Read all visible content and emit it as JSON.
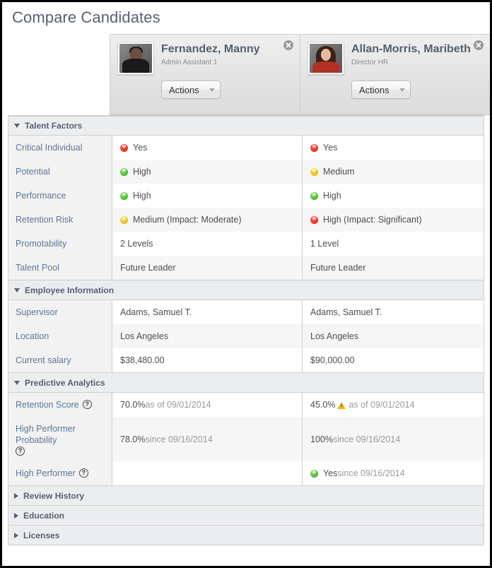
{
  "page": {
    "title": "Compare Candidates"
  },
  "candidates": [
    {
      "name": "Fernandez, Manny",
      "job_title": "Admin Assistant 1",
      "actions_label": "Actions",
      "photo": "male-portrait-photo",
      "close_label": "Remove candidate"
    },
    {
      "name": "Allan-Morris, Maribeth",
      "job_title": "Director HR",
      "actions_label": "Actions",
      "photo": "female-portrait-photo",
      "close_label": "Remove candidate"
    }
  ],
  "sections": [
    {
      "id": "talent-factors",
      "label": "Talent Factors",
      "expanded": true,
      "rows": [
        {
          "label": "Critical Individual",
          "values": [
            {
              "dot": "red",
              "text": "Yes"
            },
            {
              "dot": "red",
              "text": "Yes"
            }
          ]
        },
        {
          "label": "Potential",
          "values": [
            {
              "dot": "green",
              "text": "High"
            },
            {
              "dot": "yellow",
              "text": "Medium"
            }
          ]
        },
        {
          "label": "Performance",
          "values": [
            {
              "dot": "green",
              "text": "High"
            },
            {
              "dot": "green",
              "text": "High"
            }
          ]
        },
        {
          "label": "Retention Risk",
          "values": [
            {
              "dot": "yellow",
              "text": "Medium (Impact: Moderate)"
            },
            {
              "dot": "red",
              "text": "High (Impact: Significant)"
            }
          ]
        },
        {
          "label": "Promotability",
          "values": [
            {
              "dot": "",
              "text": "2 Levels"
            },
            {
              "dot": "",
              "text": "1 Level"
            }
          ]
        },
        {
          "label": "Talent Pool",
          "values": [
            {
              "dot": "",
              "text": "Future Leader"
            },
            {
              "dot": "",
              "text": "Future Leader"
            }
          ]
        }
      ]
    },
    {
      "id": "employee-information",
      "label": "Employee Information",
      "expanded": true,
      "rows": [
        {
          "label": "Supervisor",
          "values": [
            {
              "dot": "",
              "text": "Adams, Samuel T."
            },
            {
              "dot": "",
              "text": "Adams, Samuel T."
            }
          ]
        },
        {
          "label": "Location",
          "values": [
            {
              "dot": "",
              "text": "Los Angeles"
            },
            {
              "dot": "",
              "text": "Los Angeles"
            }
          ]
        },
        {
          "label": "Current salary",
          "values": [
            {
              "dot": "",
              "text": "$38,480.00"
            },
            {
              "dot": "",
              "text": "$90,000.00"
            }
          ]
        }
      ]
    },
    {
      "id": "predictive-analytics",
      "label": "Predictive Analytics",
      "expanded": true,
      "rows": [
        {
          "label": "Retention Score",
          "help": true,
          "values": [
            {
              "dot": "",
              "text": "70.0%",
              "muted": " as of 09/01/2014"
            },
            {
              "dot": "",
              "text": "45.0%",
              "warn": true,
              "muted": "as of 09/01/2014"
            }
          ]
        },
        {
          "label": "High Performer Probability",
          "help": true,
          "values": [
            {
              "dot": "",
              "text": "78.0%",
              "muted": " since 09/16/2014"
            },
            {
              "dot": "",
              "text": "100%",
              "muted": " since 09/16/2014"
            }
          ]
        },
        {
          "label": "High Performer",
          "help": true,
          "values": [
            {
              "dot": "",
              "text": ""
            },
            {
              "dot": "green",
              "text": "Yes",
              "muted": " since 09/16/2014"
            }
          ]
        }
      ]
    },
    {
      "id": "review-history",
      "label": "Review History",
      "expanded": false,
      "rows": []
    },
    {
      "id": "education",
      "label": "Education",
      "expanded": false,
      "rows": []
    },
    {
      "id": "licenses",
      "label": "Licenses",
      "expanded": false,
      "rows": []
    }
  ]
}
